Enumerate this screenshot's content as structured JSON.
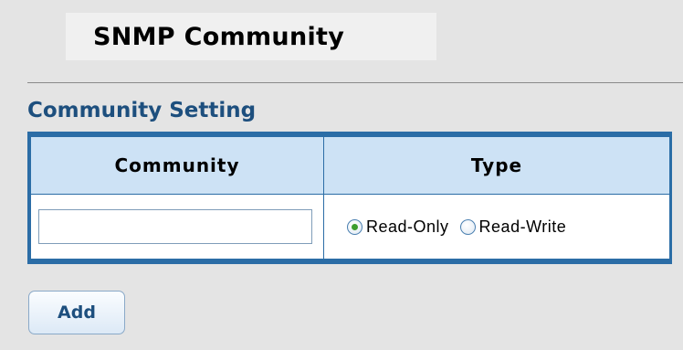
{
  "page": {
    "title": "SNMP Community",
    "section_title": "Community Setting"
  },
  "table": {
    "headers": [
      "Community",
      "Type"
    ],
    "community_value": "",
    "type_options": [
      {
        "label": "Read-Only",
        "selected": true
      },
      {
        "label": "Read-Write",
        "selected": false
      }
    ]
  },
  "actions": {
    "add_label": "Add"
  },
  "colors": {
    "accent": "#2b6da6",
    "header_bg": "#cde2f5",
    "title_text": "#1d4f7e",
    "radio_selected": "#3c9d2e"
  }
}
